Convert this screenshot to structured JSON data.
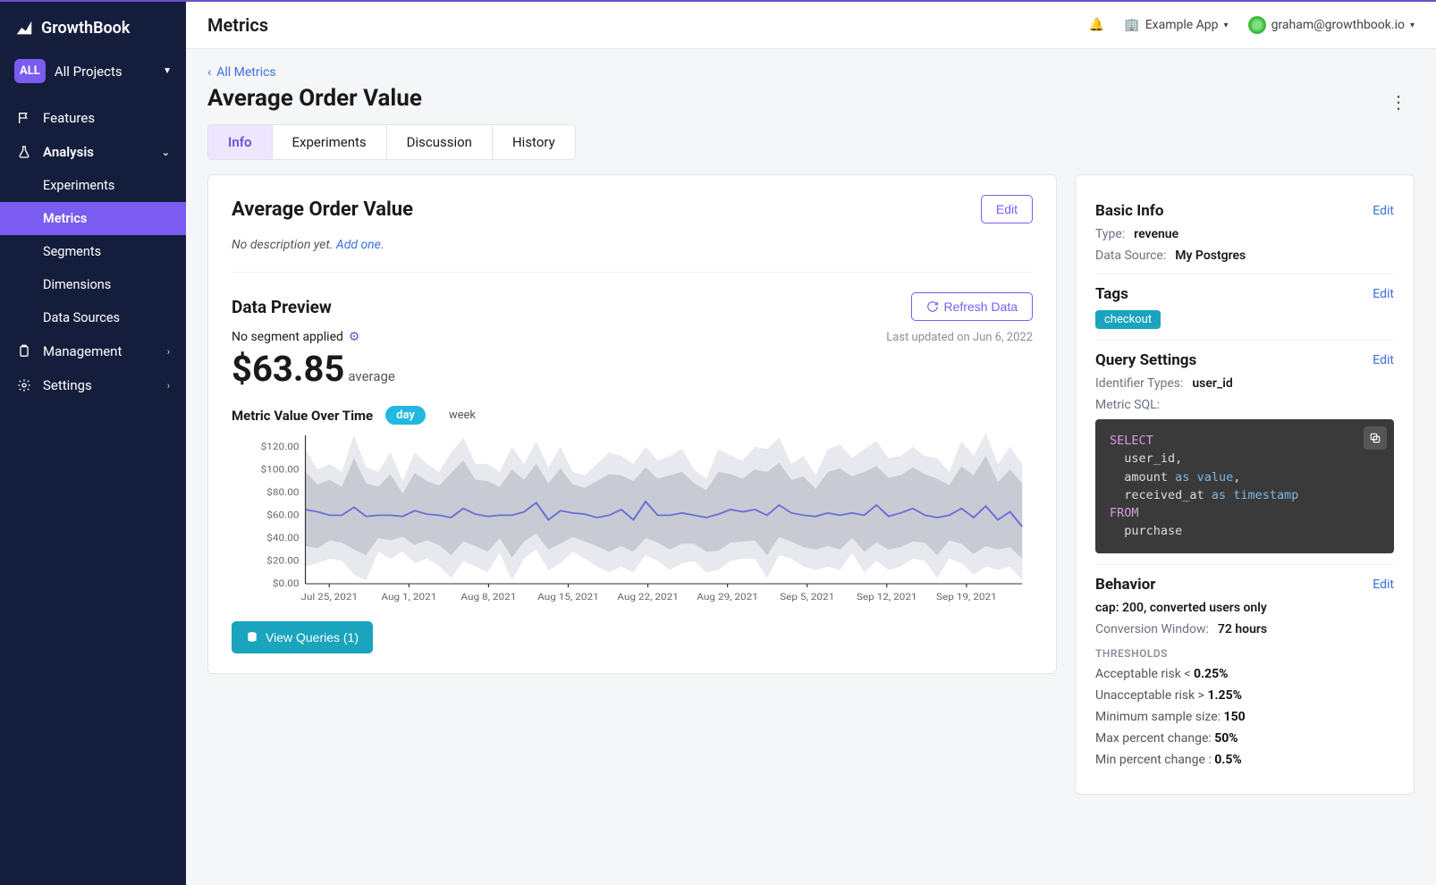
{
  "brand": "GrowthBook",
  "project": {
    "badge": "ALL",
    "label": "All Projects"
  },
  "nav": {
    "features": "Features",
    "analysis": "Analysis",
    "experiments": "Experiments",
    "metrics": "Metrics",
    "segments": "Segments",
    "dimensions": "Dimensions",
    "datasources": "Data Sources",
    "management": "Management",
    "settings": "Settings"
  },
  "topbar": {
    "title": "Metrics",
    "org": "Example App",
    "user": "graham@growthbook.io"
  },
  "breadcrumb": {
    "back": "All Metrics"
  },
  "page_title": "Average Order Value",
  "tabs": {
    "info": "Info",
    "experiments": "Experiments",
    "discussion": "Discussion",
    "history": "History"
  },
  "overview": {
    "title": "Average Order Value",
    "edit": "Edit",
    "empty_desc": "No description yet.",
    "add_one": "Add one."
  },
  "preview": {
    "title": "Data Preview",
    "refresh": "Refresh Data",
    "segment": "No segment applied",
    "updated": "Last updated on Jun 6, 2022",
    "value": "$63.85",
    "value_sub": "average",
    "chart_title": "Metric Value Over Time",
    "toggle_day": "day",
    "toggle_week": "week",
    "queries_btn": "View Queries (1)"
  },
  "chart_data": {
    "type": "line",
    "title": "Metric Value Over Time",
    "xlabel": "",
    "ylabel": "",
    "ylim": [
      0,
      130
    ],
    "y_ticks": [
      "$0.00",
      "$20.00",
      "$40.00",
      "$60.00",
      "$80.00",
      "$100.00",
      "$120.00"
    ],
    "x_ticks": [
      "Jul 25, 2021",
      "Aug 1, 2021",
      "Aug 8, 2021",
      "Aug 15, 2021",
      "Aug 22, 2021",
      "Aug 29, 2021",
      "Sep 5, 2021",
      "Sep 12, 2021",
      "Sep 19, 2021"
    ],
    "series": [
      {
        "name": "avg",
        "values": [
          65,
          63,
          60,
          60,
          67,
          59,
          60,
          60,
          59,
          64,
          61,
          60,
          58,
          66,
          61,
          59,
          60,
          60,
          63,
          71,
          56,
          64,
          62,
          61,
          58,
          60,
          65,
          56,
          72,
          60,
          60,
          62,
          60,
          58,
          61,
          65,
          63,
          65,
          60,
          69,
          62,
          60,
          59,
          62,
          60,
          62,
          60,
          69,
          59,
          62,
          66,
          60,
          58,
          60,
          66,
          58,
          68,
          56,
          63,
          50
        ]
      },
      {
        "name": "band_low",
        "values": [
          33,
          31,
          38,
          36,
          30,
          25,
          40,
          38,
          41,
          34,
          38,
          34,
          25,
          37,
          33,
          28,
          40,
          23,
          37,
          44,
          30,
          35,
          41,
          37,
          33,
          28,
          33,
          28,
          40,
          36,
          30,
          35,
          35,
          28,
          29,
          36,
          37,
          38,
          25,
          41,
          37,
          32,
          30,
          33,
          30,
          40,
          28,
          36,
          30,
          32,
          37,
          36,
          25,
          38,
          35,
          26,
          33,
          30,
          32,
          22
        ]
      },
      {
        "name": "band_high",
        "values": [
          98,
          87,
          91,
          85,
          110,
          88,
          85,
          96,
          79,
          97,
          90,
          86,
          97,
          108,
          91,
          90,
          85,
          100,
          91,
          105,
          88,
          101,
          87,
          84,
          90,
          96,
          95,
          90,
          102,
          92,
          95,
          98,
          88,
          82,
          98,
          96,
          92,
          100,
          98,
          106,
          91,
          94,
          83,
          98,
          101,
          94,
          98,
          103,
          93,
          95,
          102,
          96,
          92,
          86,
          103,
          95,
          112,
          89,
          100,
          88
        ]
      },
      {
        "name": "outer_low",
        "values": [
          15,
          18,
          22,
          20,
          8,
          3,
          28,
          22,
          28,
          18,
          22,
          16,
          5,
          20,
          15,
          10,
          27,
          3,
          22,
          30,
          12,
          18,
          28,
          22,
          15,
          10,
          15,
          10,
          25,
          20,
          12,
          18,
          20,
          10,
          12,
          20,
          22,
          22,
          5,
          25,
          22,
          15,
          12,
          15,
          12,
          27,
          10,
          20,
          12,
          15,
          22,
          20,
          5,
          22,
          18,
          8,
          15,
          12,
          15,
          3
        ]
      },
      {
        "name": "outer_high",
        "values": [
          118,
          100,
          105,
          98,
          130,
          102,
          98,
          115,
          90,
          115,
          105,
          98,
          115,
          128,
          105,
          105,
          98,
          120,
          105,
          125,
          102,
          120,
          98,
          95,
          105,
          115,
          112,
          105,
          120,
          108,
          112,
          118,
          100,
          92,
          118,
          112,
          108,
          120,
          118,
          128,
          105,
          112,
          95,
          118,
          122,
          110,
          118,
          125,
          110,
          112,
          120,
          112,
          110,
          98,
          125,
          112,
          132,
          105,
          120,
          105
        ]
      }
    ]
  },
  "basic_info": {
    "title": "Basic Info",
    "edit": "Edit",
    "type_k": "Type:",
    "type_v": "revenue",
    "ds_k": "Data Source:",
    "ds_v": "My Postgres"
  },
  "tags": {
    "title": "Tags",
    "edit": "Edit",
    "items": [
      "checkout"
    ]
  },
  "query": {
    "title": "Query Settings",
    "edit": "Edit",
    "id_k": "Identifier Types:",
    "id_v": "user_id",
    "sql_label": "Metric SQL:"
  },
  "behavior": {
    "title": "Behavior",
    "edit": "Edit",
    "summary": "cap: 200, converted users only",
    "conv_k": "Conversion Window:",
    "conv_v": "72 hours",
    "thresholds_label": "THRESHOLDS",
    "rows": [
      {
        "k": "Acceptable risk <",
        "v": "0.25%"
      },
      {
        "k": "Unacceptable risk >",
        "v": "1.25%"
      },
      {
        "k": "Minimum sample size:",
        "v": "150"
      },
      {
        "k": "Max percent change:",
        "v": "50%"
      },
      {
        "k": "Min percent change :",
        "v": "0.5%"
      }
    ]
  }
}
